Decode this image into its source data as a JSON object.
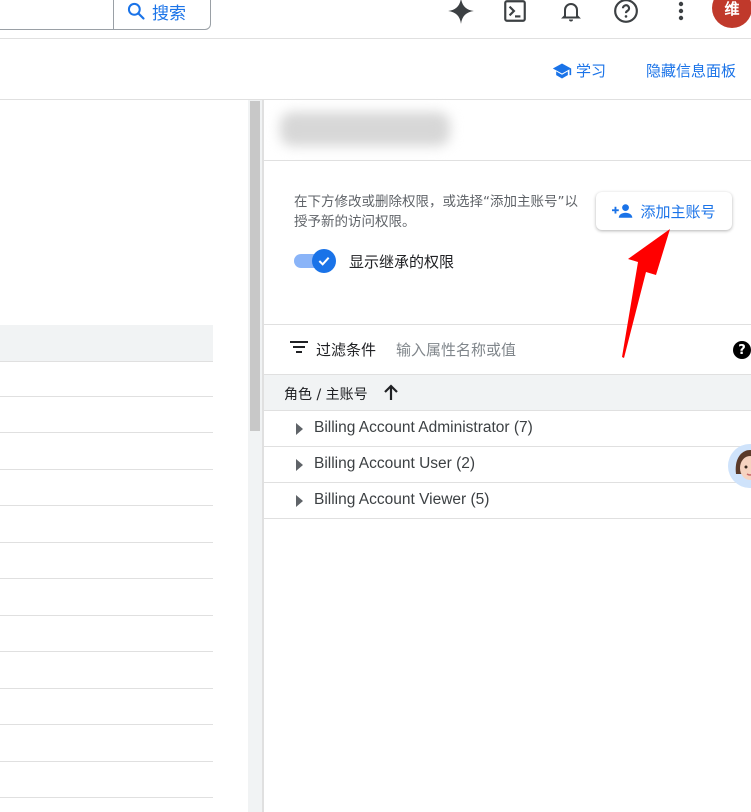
{
  "topbar": {
    "search_label": "搜索",
    "avatar_initial": "维",
    "avatar_color": "#c0392b",
    "icons": [
      "gemini-icon",
      "cloud-shell-icon",
      "notifications-icon",
      "help-icon",
      "more-vert-icon"
    ]
  },
  "subbar": {
    "learn_label": "学习",
    "hide_panel_label": "隐藏信息面板"
  },
  "panel": {
    "description": "在下方修改或删除权限，或选择“添加主账号”以授予新的访问权限。",
    "add_principal_label": "添加主账号",
    "show_inherited_label": "显示继承的权限",
    "show_inherited_on": true,
    "filter_label": "过滤条件",
    "filter_placeholder": "输入属性名称或值",
    "table_header": "角色 / 主账号",
    "roles": [
      {
        "label": "Billing Account Administrator (7)"
      },
      {
        "label": "Billing Account User (2)"
      },
      {
        "label": "Billing Account Viewer (5)"
      }
    ]
  },
  "colors": {
    "accent": "#1a73e8",
    "annotation_arrow": "#ff0000"
  }
}
